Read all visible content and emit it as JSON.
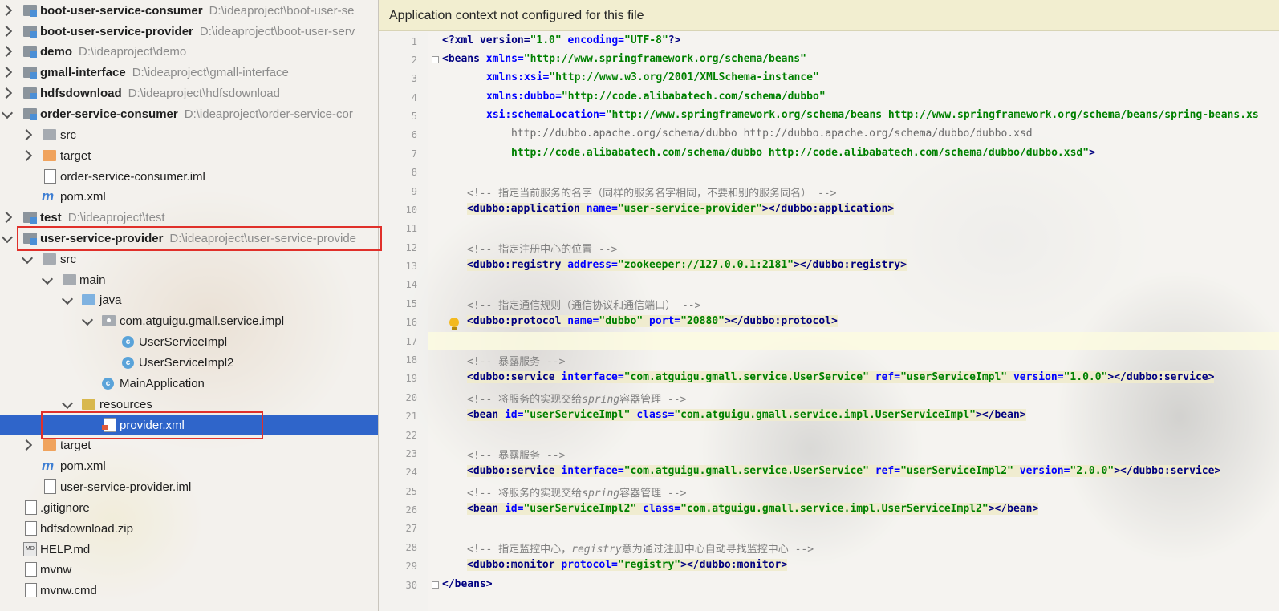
{
  "tree": {
    "items": [
      {
        "name": "boot-user-service-consumer",
        "path": "D:\\ideaproject\\boot-user-se"
      },
      {
        "name": "boot-user-service-provider",
        "path": "D:\\ideaproject\\boot-user-serv"
      },
      {
        "name": "demo",
        "path": "D:\\ideaproject\\demo"
      },
      {
        "name": "gmall-interface",
        "path": "D:\\ideaproject\\gmall-interface"
      },
      {
        "name": "hdfsdownload",
        "path": "D:\\ideaproject\\hdfsdownload"
      },
      {
        "name": "order-service-consumer",
        "path": "D:\\ideaproject\\order-service-cor"
      },
      {
        "name": "src",
        "path": ""
      },
      {
        "name": "target",
        "path": ""
      },
      {
        "name": "order-service-consumer.iml",
        "path": ""
      },
      {
        "name": "pom.xml",
        "path": ""
      },
      {
        "name": "test",
        "path": "D:\\ideaproject\\test"
      },
      {
        "name": "user-service-provider",
        "path": "D:\\ideaproject\\user-service-provide"
      },
      {
        "name": "src",
        "path": ""
      },
      {
        "name": "main",
        "path": ""
      },
      {
        "name": "java",
        "path": ""
      },
      {
        "name": "com.atguigu.gmall.service.impl",
        "path": ""
      },
      {
        "name": "UserServiceImpl",
        "path": ""
      },
      {
        "name": "UserServiceImpl2",
        "path": ""
      },
      {
        "name": "MainApplication",
        "path": ""
      },
      {
        "name": "resources",
        "path": ""
      },
      {
        "name": "provider.xml",
        "path": ""
      },
      {
        "name": "target",
        "path": ""
      },
      {
        "name": "pom.xml",
        "path": ""
      },
      {
        "name": "user-service-provider.iml",
        "path": ""
      },
      {
        "name": ".gitignore",
        "path": ""
      },
      {
        "name": "hdfsdownload.zip",
        "path": ""
      },
      {
        "name": "HELP.md",
        "path": ""
      },
      {
        "name": "mvnw",
        "path": ""
      },
      {
        "name": "mvnw.cmd",
        "path": ""
      }
    ]
  },
  "editor": {
    "banner": "Application context not configured for this file",
    "lines": [
      {
        "n": "1"
      },
      {
        "n": "2"
      },
      {
        "n": "3"
      },
      {
        "n": "4"
      },
      {
        "n": "5"
      },
      {
        "n": "6"
      },
      {
        "n": "7"
      },
      {
        "n": "8"
      },
      {
        "n": "9"
      },
      {
        "n": "10"
      },
      {
        "n": "11"
      },
      {
        "n": "12"
      },
      {
        "n": "13"
      },
      {
        "n": "14"
      },
      {
        "n": "15"
      },
      {
        "n": "16"
      },
      {
        "n": "17"
      },
      {
        "n": "18"
      },
      {
        "n": "19"
      },
      {
        "n": "20"
      },
      {
        "n": "21"
      },
      {
        "n": "22"
      },
      {
        "n": "23"
      },
      {
        "n": "24"
      },
      {
        "n": "25"
      },
      {
        "n": "26"
      },
      {
        "n": "27"
      },
      {
        "n": "28"
      },
      {
        "n": "29"
      },
      {
        "n": "30"
      }
    ],
    "code": {
      "l1": [
        "<?xml version=",
        "\"1.0\"",
        " encoding=",
        "\"UTF-8\"",
        "?>"
      ],
      "l2": [
        "<beans ",
        "xmlns=",
        "\"http://www.springframework.org/schema/beans\""
      ],
      "l3": [
        "xmlns:xsi=",
        "\"http://www.w3.org/2001/XMLSchema-instance\""
      ],
      "l4": [
        "xmlns:dubbo=",
        "\"http://code.alibabatech.com/schema/dubbo\""
      ],
      "l5": [
        "xsi:schemaLocation=",
        "\"http://www.springframework.org/schema/beans http://www.springframework.org/schema/beans/spring-beans.xs"
      ],
      "l6": "http://dubbo.apache.org/schema/dubbo http://dubbo.apache.org/schema/dubbo/dubbo.xsd",
      "l7": [
        "http://code.alibabatech.com/schema/dubbo http://code.alibabatech.com/schema/dubbo/dubbo.xsd\"",
        ">"
      ],
      "l9": "<!-- 指定当前服务的名字（同样的服务名字相同，不要和别的服务同名） -->",
      "l10": [
        "<dubbo:application ",
        "name=",
        "\"user-service-provider\"",
        "></dubbo:application>"
      ],
      "l12": "<!-- 指定注册中心的位置 -->",
      "l13": [
        "<dubbo:registry ",
        "address=",
        "\"zookeeper://127.0.0.1:2181\"",
        "></dubbo:registry>"
      ],
      "l15": "<!-- 指定通信规则（通信协议和通信端口） -->",
      "l16": [
        "<dubbo:protocol ",
        "name=",
        "\"dubbo\"",
        " port=",
        "\"20880\"",
        "></dubbo:protocol>"
      ],
      "l18": "<!-- 暴露服务 -->",
      "l19": [
        "<dubbo:service ",
        "interface=",
        "\"com.atguigu.gmall.service.UserService\"",
        " ref=",
        "\"userServiceImpl\"",
        " version=",
        "\"1.0.0\"",
        "></dubbo:service>"
      ],
      "l20": [
        "<!-- 将服务的实现交给",
        "spring",
        "容器管理 -->"
      ],
      "l21": [
        "<bean ",
        "id=",
        "\"userServiceImpl\"",
        " class=",
        "\"com.atguigu.gmall.service.impl.UserServiceImpl\"",
        "></bean>"
      ],
      "l23": "<!-- 暴露服务 -->",
      "l24": [
        "<dubbo:service ",
        "interface=",
        "\"com.atguigu.gmall.service.UserService\"",
        " ref=",
        "\"userServiceImpl2\"",
        " version=",
        "\"2.0.0\"",
        "></dubbo:service>"
      ],
      "l25": [
        "<!-- 将服务的实现交给",
        "spring",
        "容器管理 -->"
      ],
      "l26": [
        "<bean ",
        "id=",
        "\"userServiceImpl2\"",
        " class=",
        "\"com.atguigu.gmall.service.impl.UserServiceImpl2\"",
        "></bean>"
      ],
      "l28": [
        "<!-- 指定监控中心，",
        "registry",
        "意为通过注册中心自动寻找监控中心 -->"
      ],
      "l29": [
        "<dubbo:monitor ",
        "protocol=",
        "\"registry\"",
        "></dubbo:monitor>"
      ],
      "l30": "</beans>"
    }
  },
  "colors": {
    "selection": "#2f65ca",
    "highlight_box": "#e0302a",
    "banner_bg": "#f1eecd",
    "tag": "#000080",
    "attr": "#0000ff",
    "value": "#008000",
    "comment": "#808080"
  }
}
